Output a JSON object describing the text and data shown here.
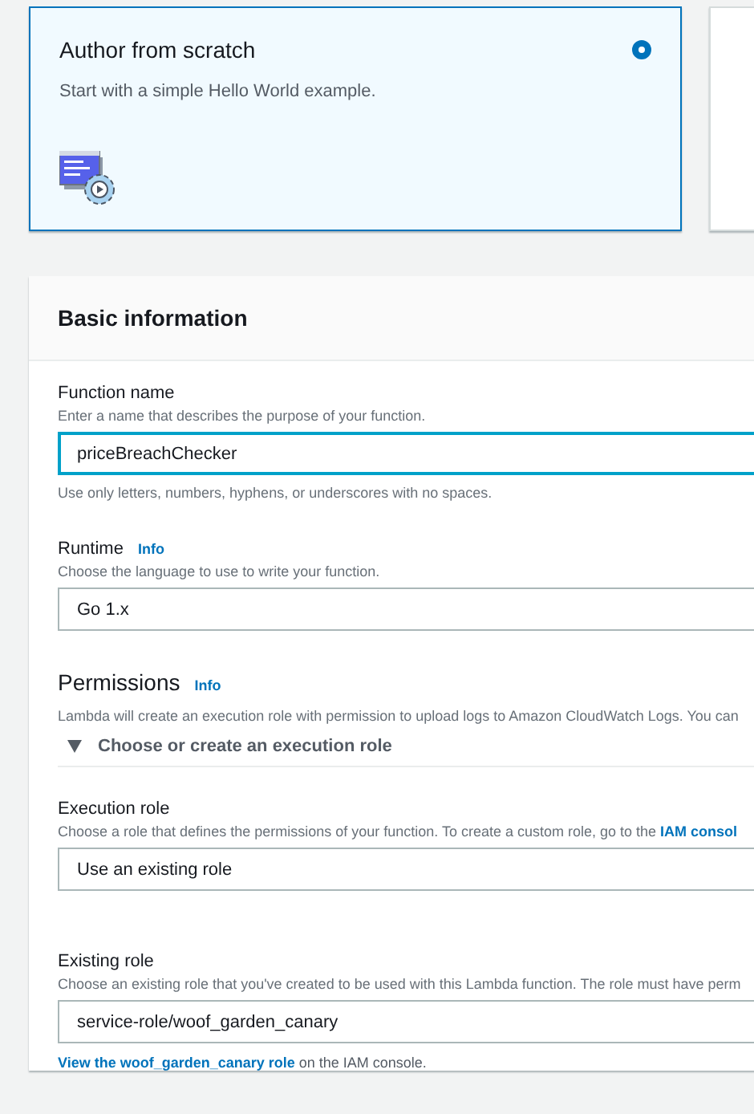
{
  "cards": [
    {
      "title": "Author from scratch",
      "description": "Start with a simple Hello World example.",
      "selected": true
    },
    {
      "selected": false
    }
  ],
  "basic_information": {
    "title": "Basic information",
    "function_name": {
      "label": "Function name",
      "hint": "Enter a name that describes the purpose of your function.",
      "value": "priceBreachChecker",
      "focused": true,
      "help": "Use only letters, numbers, hyphens, or underscores with no spaces."
    },
    "runtime": {
      "label": "Runtime",
      "info": "Info",
      "hint": "Choose the language to use to write your function.",
      "value": "Go 1.x"
    },
    "permissions": {
      "title": "Permissions",
      "info": "Info",
      "description": "Lambda will create an execution role with permission to upload logs to Amazon CloudWatch Logs. You can",
      "expander": {
        "label": "Choose or create an execution role",
        "expanded": true
      },
      "execution_role": {
        "label": "Execution role",
        "hint": "Choose a role that defines the permissions of your function. To create a custom role, go to the ",
        "hint_link": "IAM consol",
        "value": "Use an existing role"
      },
      "existing_role": {
        "label": "Existing role",
        "hint": "Choose an existing role that you've created to be used with this Lambda function. The role must have perm",
        "value": "service-role/woof_garden_canary",
        "link": "View the woof_garden_canary role",
        "link_suffix": " on the IAM console."
      }
    }
  }
}
